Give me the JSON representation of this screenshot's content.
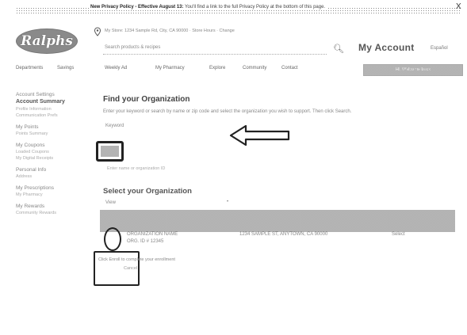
{
  "banner": {
    "text_bold": "New Privacy Policy - Effective August 13:",
    "text_rest": " You'll find a link to the full Privacy Policy at the bottom of this page.",
    "close": "X"
  },
  "header": {
    "logo": "Ralphs",
    "store_line": "My Store: 1234 Sample Rd, City, CA 90000 · Store Hours · Change",
    "search_placeholder": "Search products & recipes",
    "my_account": "My Account",
    "lang": "Español",
    "icons": [
      "pin-icon",
      "search-icon"
    ]
  },
  "nav": {
    "items": [
      "Departments",
      "Savings",
      "Weekly Ad",
      "My Pharmacy",
      "Explore",
      "Community",
      "Contact"
    ],
    "button": "Hi, Welcome back"
  },
  "sidebar": {
    "items": [
      {
        "label": "Account Settings",
        "kind": "link"
      },
      {
        "label": "Account Summary",
        "kind": "bold"
      },
      {
        "label": "Profile Information",
        "kind": "sub"
      },
      {
        "label": "Communication Prefs",
        "kind": "sub"
      },
      {
        "label": "My Points",
        "kind": "link"
      },
      {
        "label": "Points Summary",
        "kind": "sub"
      },
      {
        "label": "My Coupons",
        "kind": "link"
      },
      {
        "label": "Loaded Coupons",
        "kind": "sub"
      },
      {
        "label": "My Digital Receipts",
        "kind": "sub"
      },
      {
        "label": "Personal Info",
        "kind": "link"
      },
      {
        "label": "Address",
        "kind": "sub"
      },
      {
        "label": "My Prescriptions",
        "kind": "link"
      },
      {
        "label": "My Pharmacy",
        "kind": "sub"
      },
      {
        "label": "My Rewards",
        "kind": "link"
      },
      {
        "label": "Community Rewards",
        "kind": "sub"
      }
    ]
  },
  "main": {
    "find_title": "Find your Organization",
    "find_desc": "Enter your keyword or search by name or zip code and select the organization you wish to support. Then click Search.",
    "keyword_label": "Keyword",
    "keyword_hint": "Enter name or organization ID",
    "select_title": "Select your Organization",
    "view_label": "View",
    "view_value": "•",
    "row": {
      "name": "ORGANIZATION NAME",
      "id": "ORG. ID # 12345",
      "address": "1234 SAMPLE ST, ANYTOWN, CA 90000",
      "action": "Select"
    },
    "enroll_text": "Click Enroll to complete your enrollment",
    "cancel": "Cancel"
  }
}
